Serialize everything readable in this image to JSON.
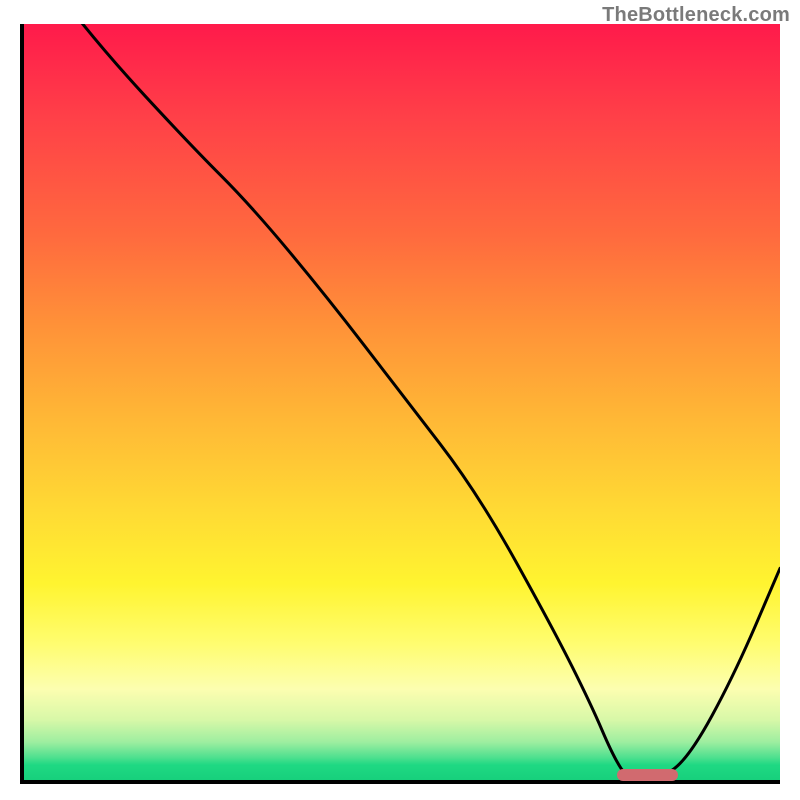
{
  "watermark": "TheBottleneck.com",
  "chart_data": {
    "type": "line",
    "title": "",
    "xlabel": "",
    "ylabel": "",
    "xlim": [
      0,
      100
    ],
    "ylim": [
      0,
      100
    ],
    "x": [
      0,
      10,
      22,
      30,
      40,
      50,
      60,
      70,
      75,
      78,
      80,
      84,
      88,
      94,
      100
    ],
    "values": [
      110,
      97,
      84,
      76,
      64,
      51,
      38,
      20,
      10,
      3,
      0,
      0,
      3,
      14,
      28
    ],
    "optimum_band": {
      "x_start": 78,
      "x_end": 86,
      "y": 1.2
    },
    "gradient_stops": [
      {
        "pct": 0,
        "color": "#ff1a4b"
      },
      {
        "pct": 12,
        "color": "#ff3f48"
      },
      {
        "pct": 28,
        "color": "#ff6a3e"
      },
      {
        "pct": 40,
        "color": "#ff9238"
      },
      {
        "pct": 52,
        "color": "#ffb736"
      },
      {
        "pct": 64,
        "color": "#ffd934"
      },
      {
        "pct": 74,
        "color": "#fff430"
      },
      {
        "pct": 82,
        "color": "#fffd70"
      },
      {
        "pct": 88,
        "color": "#fcfeb0"
      },
      {
        "pct": 92,
        "color": "#d8f8a8"
      },
      {
        "pct": 95,
        "color": "#9deea0"
      },
      {
        "pct": 97,
        "color": "#4fe08f"
      },
      {
        "pct": 98,
        "color": "#1fd983"
      },
      {
        "pct": 100,
        "color": "#17d07c"
      }
    ]
  }
}
